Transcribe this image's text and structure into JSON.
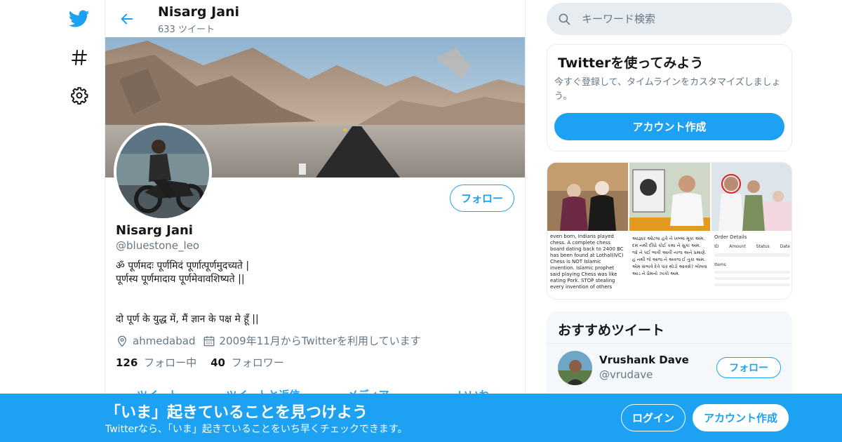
{
  "colors": {
    "accent": "#1da1f2",
    "muted": "#657786",
    "text": "#14171a",
    "border": "#e6ecf0"
  },
  "nav": {
    "items": [
      {
        "icon": "twitter-bird-icon"
      },
      {
        "icon": "hashtag-icon"
      },
      {
        "icon": "gear-icon"
      }
    ]
  },
  "header": {
    "back_icon": "arrow-left-icon",
    "name": "Nisarg Jani",
    "tweet_count": "633 ツイート"
  },
  "profile": {
    "name": "Nisarg Jani",
    "handle": "@bluestone_leo",
    "follow_label": "フォロー",
    "bio_lines": [
      "ॐ पूर्णमदः पूर्णमिदं पूर्णात्पूर्णमुदच्यते |",
      "पूर्णस्य पूर्णमादाय पूर्णमेवावशिष्यते ||",
      "",
      "दो पूर्ण के युद्ध में, मैं ज्ञान के पक्ष मे हूँ ||"
    ],
    "location": "ahmedabad",
    "joined": "2009年11月からTwitterを利用しています",
    "following_count": "126",
    "following_label": "フォロー中",
    "followers_count": "40",
    "followers_label": "フォロワー"
  },
  "tabs_peek": [
    "ツイート",
    "ツイートと返信",
    "メディア",
    "いいね"
  ],
  "search": {
    "placeholder": "キーワード検索",
    "value": ""
  },
  "signup_card": {
    "title": "Twitterを使ってみよう",
    "text": "今すぐ登録して、タイムラインをカスタマイズしましょう。",
    "button": "アカウント作成"
  },
  "media_grid": {
    "tile4_text": "even born, Indians played chess. A complete chess board dating back to 2400 BC has been found at Lothal(IVC) Chess is NOT Islamic invention. Islamic prophet said playing Chess was like eating Pork. STOP stealing every invention of others",
    "tile5_text": "આજ્ઞાર ઓટલા હવે ને ખબ્બા મૂકા અમ. દમ નથી દીધો કોઈ કથા ને સુકા અમ. જો ને પઈ ભાવી આવી નાજ અને પ્રમાણે. હ નથી જે આજ ને અવજ ઈ તુકા અમ. એમ સંભાવે દેવે પાર થોડો આવશે? બોલવા આડ ને પ્રેમનો ઝાકો અમ.",
    "tile6_title": "Order Details",
    "tile6_headers": [
      "ID",
      "Amount",
      "Status",
      "Date"
    ],
    "tile6_items": "Items"
  },
  "recommended": {
    "title": "おすすめツイート",
    "user_name": "Vrushank Dave",
    "user_handle": "@vrudave",
    "follow_label": "フォロー"
  },
  "bottom_bar": {
    "title": "「いま」起きていることを見つけよう",
    "subtitle": "Twitterなら、「いま」起きていることをいち早くチェックできます。",
    "login": "ログイン",
    "signup": "アカウント作成"
  }
}
